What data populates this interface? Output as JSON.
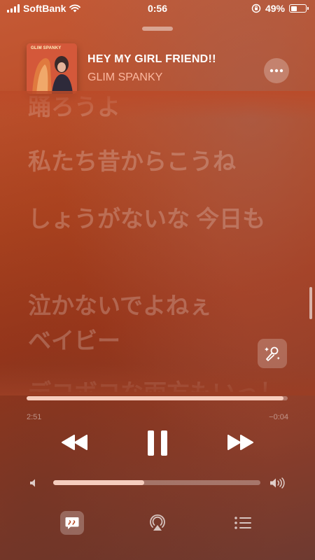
{
  "status_bar": {
    "carrier": "SoftBank",
    "time": "0:56",
    "battery_percent_label": "49%",
    "battery_level": 0.49
  },
  "now_playing": {
    "title": "HEY MY GIRL FRIEND!!",
    "artist": "GLIM SPANKY",
    "album_art_text": "GLIM SPANKY"
  },
  "lyrics": {
    "lines": [
      "踊ろうよ",
      "私たち昔からこうね",
      "しょうがないな 今日も",
      "泣かないでよねぇ",
      "ベイビー",
      "デコボコな両方もいっしょ"
    ]
  },
  "playback": {
    "elapsed": "2:51",
    "remaining": "−0:04",
    "progress": 0.985,
    "volume": 0.44
  },
  "colors": {
    "accent_artist": "#ffbea5",
    "background_top": "#c55a36",
    "background_bottom": "#6e3a30"
  },
  "icons": {
    "more": "ellipsis-icon",
    "sing": "magic-microphone-icon",
    "rewind": "backward-icon",
    "pause": "pause-icon",
    "forward": "forward-icon",
    "volume_low": "speaker-low-icon",
    "volume_high": "speaker-high-icon",
    "lyrics": "quote-bubble-icon",
    "airplay": "airplay-icon",
    "queue": "list-icon"
  }
}
